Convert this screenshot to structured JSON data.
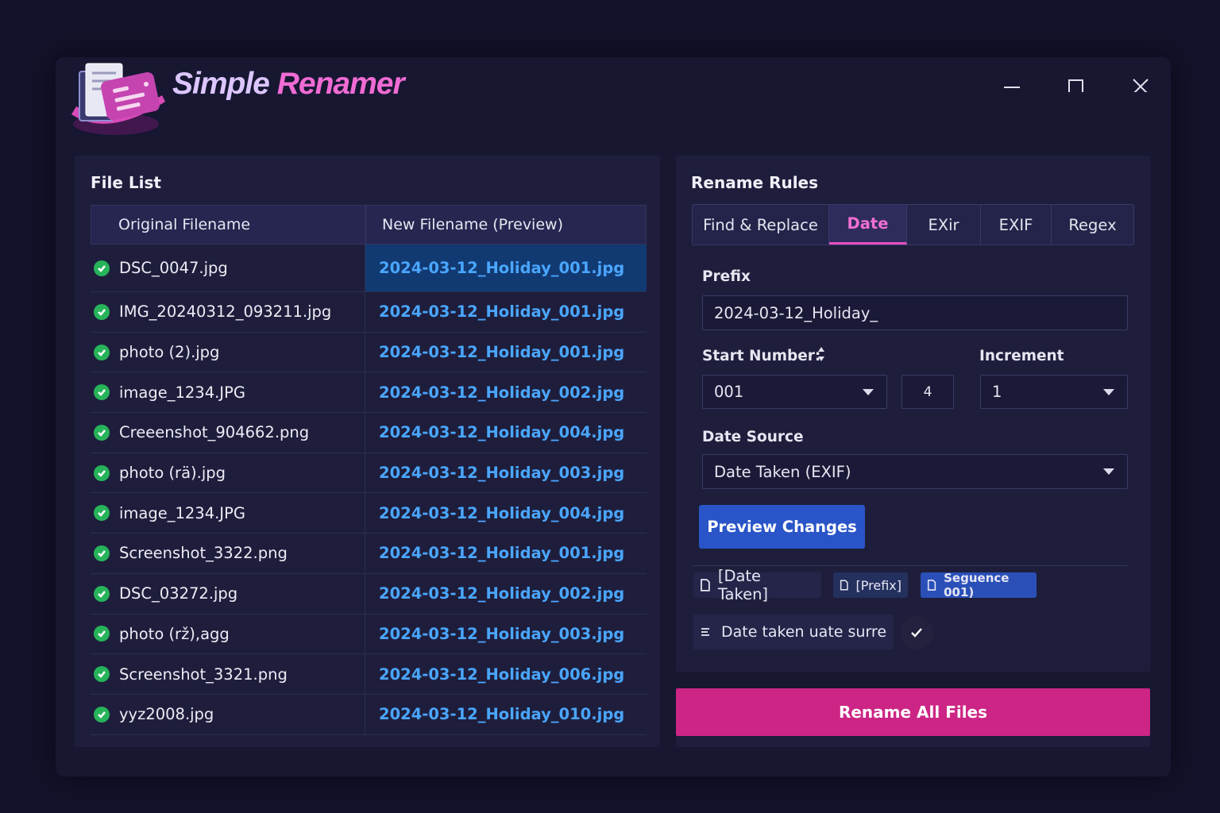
{
  "app": {
    "title_part1": "Simple",
    "title_part2": "Renamer"
  },
  "window_controls": {
    "minimize": "minimize-icon",
    "maximize": "maximize-icon",
    "close": "close-icon"
  },
  "file_list": {
    "title": "File List",
    "columns": [
      "Original Filename",
      "New Filename (Preview)"
    ],
    "rows": [
      {
        "original": "DSC_0047.jpg",
        "new": "2024-03-12_Holiday_001.jpg"
      },
      {
        "original": "IMG_20240312_093211.jpg",
        "new": "2024-03-12_Holiday_001.jpg"
      },
      {
        "original": "photo (2).jpg",
        "new": "2024-03-12_Holiday_001.jpg"
      },
      {
        "original": "image_1234.JPG",
        "new": "2024-03-12_Holiday_002.jpg"
      },
      {
        "original": "Creeenshot_904662.png",
        "new": "2024-03-12_Holiday_004.jpg"
      },
      {
        "original": "photo (rä).jpg",
        "new": "2024-03-12_Holiday_003.jpg"
      },
      {
        "original": "image_1234.JPG",
        "new": "2024-03-12_Holiday_004.jpg"
      },
      {
        "original": "Screenshot_3322.png",
        "new": "2024-03-12_Holiday_001.jpg"
      },
      {
        "original": "DSC_03272.jpg",
        "new": "2024-03-12_Holiday_002.jpg"
      },
      {
        "original": "photo (rž),agg",
        "new": "2024-03-12_Holiday_003.jpg"
      },
      {
        "original": "Screenshot_3321.png",
        "new": "2024-03-12_Holiday_006.jpg"
      },
      {
        "original": "yyz2008.jpg",
        "new": "2024-03-12_Holiday_010.jpg"
      }
    ]
  },
  "rules": {
    "title": "Rename Rules",
    "tabs": [
      "Find & Replace",
      "Date",
      "EXir",
      "EXIF",
      "Regex"
    ],
    "active_tab": "Date",
    "prefix_label": "Prefix",
    "prefix_value": "2024-03-12_Holiday_",
    "start_label": "Start Number:",
    "start_value": "001",
    "step_value": "4",
    "increment_label": "Increment",
    "increment_value": "1",
    "date_source_label": "Date Source",
    "date_source_value": "Date Taken (EXIF)",
    "preview_button": "Preview Changes",
    "tokens": [
      "[Date Taken]",
      "[Prefix]",
      "Seguence 001)"
    ],
    "summary_text": "Date taken uate surre"
  },
  "rename_button": "Rename All Files",
  "colors": {
    "accent_pink": "#cc2585",
    "accent_blue": "#2a55c8",
    "link_blue": "#4aa6ff",
    "ok_green": "#27b35a"
  }
}
